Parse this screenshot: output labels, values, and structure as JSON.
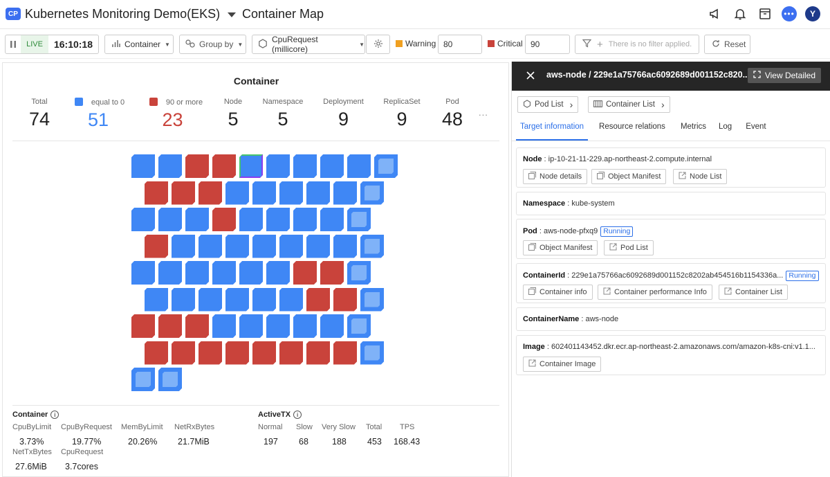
{
  "header": {
    "badge": "CP",
    "project_name": "Kubernetes Monitoring Demo(EKS)",
    "page_title": "Container Map",
    "chat_glyph": "•••",
    "avatar_letter": "Y"
  },
  "toolbar": {
    "live_label": "LIVE",
    "time": "16:10:18",
    "container_dropdown": "Container",
    "groupby_label": "Group by",
    "metric_dropdown": "CpuRequest (millicore)",
    "warning_label": "Warning",
    "warning_value": "80",
    "warning_color": "#f0a020",
    "critical_label": "Critical",
    "critical_value": "90",
    "critical_color": "#c9433b",
    "filter_placeholder": "There is no filter applied.",
    "reset_label": "Reset"
  },
  "panel": {
    "title": "Container",
    "stats": [
      {
        "label": "Total",
        "value": "74"
      },
      {
        "label": "equal to 0",
        "value": "51"
      },
      {
        "label": "90 or more",
        "value": "23"
      },
      {
        "label": "Node",
        "value": "5"
      },
      {
        "label": "Namespace",
        "value": "5"
      },
      {
        "label": "Deployment",
        "value": "9"
      },
      {
        "label": "ReplicaSet",
        "value": "9"
      },
      {
        "label": "Pod",
        "value": "48"
      }
    ],
    "more": "...",
    "legend_blue": "#3f87f5",
    "legend_red": "#c9433b"
  },
  "bottom": {
    "container_title": "Container",
    "container_metrics": [
      {
        "label": "CpuByLimit",
        "value": "3.73%"
      },
      {
        "label": "CpuByRequest",
        "value": "19.77%"
      },
      {
        "label": "MemByLimit",
        "value": "20.26%"
      },
      {
        "label": "NetRxBytes",
        "value": "21.7MiB"
      },
      {
        "label": "NetTxBytes",
        "value": "27.6MiB"
      },
      {
        "label": "CpuRequest",
        "value": "3.7cores"
      }
    ],
    "activetx_title": "ActiveTX",
    "activetx_metrics": [
      {
        "label": "Normal",
        "value": "197"
      },
      {
        "label": "Slow",
        "value": "68"
      },
      {
        "label": "Very Slow",
        "value": "188"
      },
      {
        "label": "Total",
        "value": "453"
      },
      {
        "label": "TPS",
        "value": "168.43"
      }
    ]
  },
  "right_panel": {
    "title": "aws-node / 229e1a75766ac6092689d001152c820...",
    "view_detailed": "View Detailed",
    "pod_list": "Pod List",
    "container_list": "Container List",
    "tabs": [
      "Target information",
      "Resource relations",
      "Metrics",
      "Log",
      "Event"
    ],
    "node_key": "Node",
    "node_value": "ip-10-21-11-229.ap-northeast-2.compute.internal",
    "node_buttons": [
      "Node details",
      "Object Manifest",
      "Node List"
    ],
    "namespace_key": "Namespace",
    "namespace_value": "kube-system",
    "pod_key": "Pod",
    "pod_value": "aws-node-pfxq9",
    "pod_status": "Running",
    "pod_buttons": [
      "Object Manifest",
      "Pod List"
    ],
    "containerid_key": "ContainerId",
    "containerid_value": "229e1a75766ac6092689d001152c8202ab454516b1154336a...",
    "containerid_status": "Running",
    "container_buttons": [
      "Container info",
      "Container performance Info",
      "Container List"
    ],
    "containername_key": "ContainerName",
    "containername_value": "aws-node",
    "image_key": "Image",
    "image_value": "602401143452.dkr.ecr.ap-northeast-2.amazonaws.com/amazon-k8s-cni:v1.1...",
    "image_buttons": [
      "Container Image"
    ]
  },
  "map": {
    "rows": [
      "bbrrsbbbbp",
      "rrrbbbbbp",
      "bbbrbbbbp",
      "rbbbbbbbp",
      "bbbbbbrrp",
      "bbbbbbrrp",
      "rrrbbbbbp",
      "rrrrrrrrp",
      "pp"
    ]
  }
}
